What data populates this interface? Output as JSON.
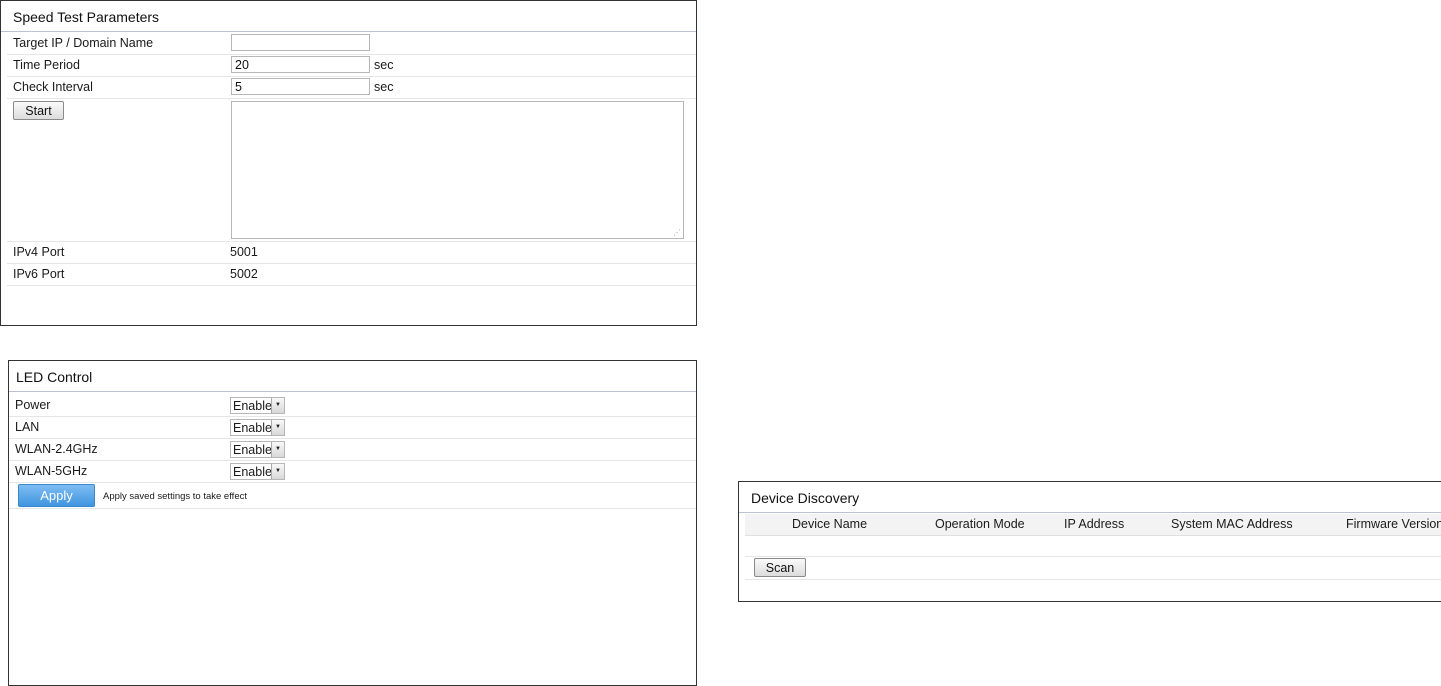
{
  "speed_test": {
    "title": "Speed Test Parameters",
    "target_label": "Target IP / Domain Name",
    "target_value": "",
    "time_label": "Time Period",
    "time_value": "20",
    "time_unit": "sec",
    "interval_label": "Check Interval",
    "interval_value": "5",
    "interval_unit": "sec",
    "start_label": "Start",
    "output_text": "",
    "ipv4_label": "IPv4 Port",
    "ipv4_value": "5001",
    "ipv6_label": "IPv6 Port",
    "ipv6_value": "5002"
  },
  "led_control": {
    "title": "LED Control",
    "rows": [
      {
        "label": "Power",
        "value": "Enable"
      },
      {
        "label": "LAN",
        "value": "Enable"
      },
      {
        "label": "WLAN-2.4GHz",
        "value": "Enable"
      },
      {
        "label": "WLAN-5GHz",
        "value": "Enable"
      }
    ],
    "apply_label": "Apply",
    "apply_hint": "Apply saved settings to take effect"
  },
  "device_discovery": {
    "title": "Device Discovery",
    "columns": [
      "Device Name",
      "Operation Mode",
      "IP Address",
      "System MAC Address",
      "Firmware Version"
    ],
    "scan_label": "Scan"
  },
  "icons": {
    "dropdown": "chevron-down-icon",
    "resize": "resize-grip-icon"
  }
}
